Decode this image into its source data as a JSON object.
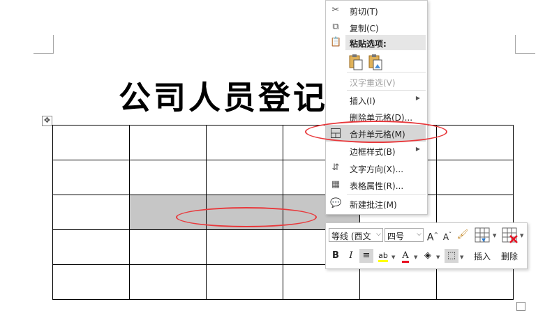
{
  "document": {
    "title": "公司人员登记表",
    "table_rows": 5,
    "table_cols": 6,
    "selected_cells": "row 3, columns 2-4"
  },
  "context_menu": {
    "items": [
      {
        "icon": "scissors-icon",
        "label": "剪切(T)",
        "enabled": true
      },
      {
        "icon": "copy-icon",
        "label": "复制(C)",
        "enabled": true
      },
      {
        "icon": "paste-icon",
        "label": "粘贴选项:",
        "enabled": true
      },
      {
        "label": "汉字重选(V)",
        "enabled": false
      },
      {
        "label": "插入(I)",
        "submenu": true,
        "enabled": true
      },
      {
        "label": "删除单元格(D)...",
        "enabled": true
      },
      {
        "icon": "merge-cells-icon",
        "label": "合并单元格(M)",
        "enabled": true,
        "highlighted": true
      },
      {
        "label": "边框样式(B)",
        "submenu": true,
        "enabled": true
      },
      {
        "icon": "text-direction-icon",
        "label": "文字方向(X)...",
        "enabled": true
      },
      {
        "icon": "table-properties-icon",
        "label": "表格属性(R)...",
        "enabled": true
      },
      {
        "icon": "new-comment-icon",
        "label": "新建批注(M)",
        "enabled": true
      }
    ]
  },
  "mini_toolbar": {
    "font_name": "等线 (西文",
    "font_size": "四号",
    "insert_label": "插入",
    "delete_label": "删除",
    "bold": "B",
    "italic": "I",
    "font_color_glyph": "A",
    "grow_font_glyph": "A",
    "shrink_font_glyph": "A",
    "highlight_glyph": "ab",
    "font_color_hex": "#e81123",
    "highlight_color_hex": "#ffff00"
  },
  "colors": {
    "annotation_red": "#e8393c",
    "menu_highlight": "#d6d6d6",
    "cell_selected": "#c6c6c6"
  }
}
